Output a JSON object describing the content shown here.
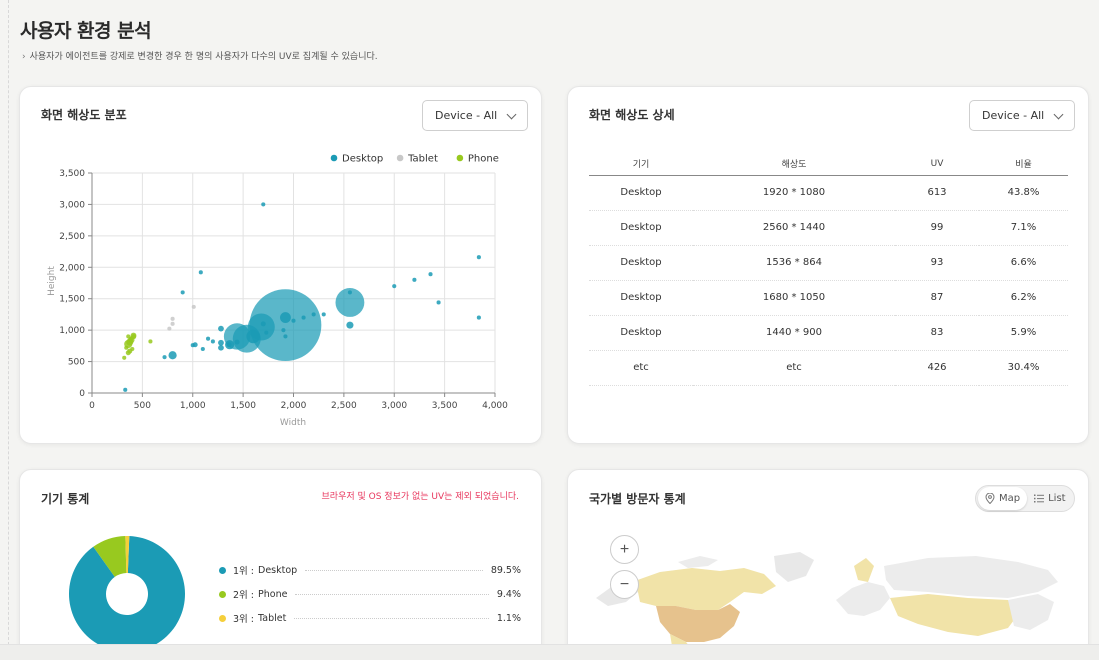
{
  "page": {
    "title": "사용자 환경 분석",
    "description": "사용자가 에이전트를 강제로 변경한 경우 한 명의 사용자가 다수의 UV로 집계될 수 있습니다."
  },
  "resolution_chart": {
    "title": "화면 해상도 분포",
    "device_filter": "Device - All",
    "legend": [
      {
        "name": "Desktop",
        "color": "#1b9bb5"
      },
      {
        "name": "Tablet",
        "color": "#c8c8c8"
      },
      {
        "name": "Phone",
        "color": "#98c91f"
      }
    ],
    "xlabel": "Width",
    "ylabel": "Height",
    "x_ticks": [
      "0",
      "500",
      "1,000",
      "1,500",
      "2,000",
      "2,500",
      "3,000",
      "3,500",
      "4,000"
    ],
    "y_ticks": [
      "0",
      "500",
      "1,000",
      "1,500",
      "2,000",
      "2,500",
      "3,000",
      "3,500"
    ]
  },
  "chart_data": {
    "type": "scatter",
    "xlabel": "Width",
    "ylabel": "Height",
    "xlim": [
      0,
      4000
    ],
    "ylim": [
      0,
      3500
    ],
    "grid": true,
    "legend_position": "top-right",
    "series": [
      {
        "name": "Desktop",
        "color": "#1b9bb5",
        "points": [
          {
            "x": 1920,
            "y": 1080,
            "uv": 613
          },
          {
            "x": 2560,
            "y": 1440,
            "uv": 99
          },
          {
            "x": 1536,
            "y": 864,
            "uv": 93
          },
          {
            "x": 1680,
            "y": 1050,
            "uv": 87
          },
          {
            "x": 1440,
            "y": 900,
            "uv": 83
          },
          {
            "x": 1600,
            "y": 900,
            "uv": 22
          },
          {
            "x": 1366,
            "y": 768,
            "uv": 10
          },
          {
            "x": 1920,
            "y": 1200,
            "uv": 14
          },
          {
            "x": 2560,
            "y": 1080,
            "uv": 6
          },
          {
            "x": 1280,
            "y": 1024,
            "uv": 4
          },
          {
            "x": 1280,
            "y": 720,
            "uv": 4
          },
          {
            "x": 1280,
            "y": 800,
            "uv": 4
          },
          {
            "x": 1360,
            "y": 768,
            "uv": 3
          },
          {
            "x": 1440,
            "y": 810,
            "uv": 3
          },
          {
            "x": 800,
            "y": 600,
            "uv": 8
          },
          {
            "x": 1024,
            "y": 768,
            "uv": 3
          },
          {
            "x": 1152,
            "y": 864,
            "uv": 2
          },
          {
            "x": 1700,
            "y": 1100,
            "uv": 3
          },
          {
            "x": 1730,
            "y": 960,
            "uv": 2
          },
          {
            "x": 1900,
            "y": 1000,
            "uv": 2
          },
          {
            "x": 1920,
            "y": 900,
            "uv": 2
          },
          {
            "x": 2000,
            "y": 1150,
            "uv": 2
          },
          {
            "x": 2100,
            "y": 1200,
            "uv": 2
          },
          {
            "x": 2200,
            "y": 1250,
            "uv": 2
          },
          {
            "x": 2300,
            "y": 1250,
            "uv": 2
          },
          {
            "x": 2560,
            "y": 1600,
            "uv": 2
          },
          {
            "x": 3000,
            "y": 1700,
            "uv": 2
          },
          {
            "x": 3200,
            "y": 1800,
            "uv": 2
          },
          {
            "x": 3360,
            "y": 1890,
            "uv": 2
          },
          {
            "x": 3440,
            "y": 1440,
            "uv": 2
          },
          {
            "x": 3840,
            "y": 2160,
            "uv": 2
          },
          {
            "x": 3840,
            "y": 1200,
            "uv": 2
          },
          {
            "x": 1080,
            "y": 1920,
            "uv": 2
          },
          {
            "x": 1700,
            "y": 3000,
            "uv": 2
          },
          {
            "x": 900,
            "y": 1600,
            "uv": 2
          },
          {
            "x": 1000,
            "y": 760,
            "uv": 2
          },
          {
            "x": 1100,
            "y": 700,
            "uv": 2
          },
          {
            "x": 1200,
            "y": 820,
            "uv": 2
          },
          {
            "x": 330,
            "y": 50,
            "uv": 2
          },
          {
            "x": 720,
            "y": 570,
            "uv": 2
          }
        ]
      },
      {
        "name": "Tablet",
        "color": "#c8c8c8",
        "points": [
          {
            "x": 800,
            "y": 1180,
            "uv": 2
          },
          {
            "x": 800,
            "y": 1100,
            "uv": 2
          },
          {
            "x": 768,
            "y": 1024,
            "uv": 2
          },
          {
            "x": 1010,
            "y": 1370,
            "uv": 2
          }
        ]
      },
      {
        "name": "Phone",
        "color": "#98c91f",
        "points": [
          {
            "x": 360,
            "y": 780,
            "uv": 8
          },
          {
            "x": 375,
            "y": 812,
            "uv": 6
          },
          {
            "x": 390,
            "y": 844,
            "uv": 5
          },
          {
            "x": 412,
            "y": 915,
            "uv": 4
          },
          {
            "x": 360,
            "y": 640,
            "uv": 3
          },
          {
            "x": 375,
            "y": 667,
            "uv": 3
          },
          {
            "x": 414,
            "y": 896,
            "uv": 3
          },
          {
            "x": 393,
            "y": 873,
            "uv": 2
          },
          {
            "x": 340,
            "y": 720,
            "uv": 2
          },
          {
            "x": 320,
            "y": 560,
            "uv": 2
          },
          {
            "x": 384,
            "y": 854,
            "uv": 2
          },
          {
            "x": 400,
            "y": 700,
            "uv": 2
          },
          {
            "x": 360,
            "y": 900,
            "uv": 2
          },
          {
            "x": 580,
            "y": 820,
            "uv": 2
          }
        ]
      }
    ]
  },
  "resolution_detail": {
    "title": "화면 해상도 상세",
    "device_filter": "Device - All",
    "columns": [
      "기기",
      "해상도",
      "UV",
      "비율"
    ],
    "rows": [
      [
        "Desktop",
        "1920 * 1080",
        "613",
        "43.8%"
      ],
      [
        "Desktop",
        "2560 * 1440",
        "99",
        "7.1%"
      ],
      [
        "Desktop",
        "1536 * 864",
        "93",
        "6.6%"
      ],
      [
        "Desktop",
        "1680 * 1050",
        "87",
        "6.2%"
      ],
      [
        "Desktop",
        "1440 * 900",
        "83",
        "5.9%"
      ],
      [
        "etc",
        "etc",
        "426",
        "30.4%"
      ]
    ]
  },
  "device_stats": {
    "title": "기기 통계",
    "note": "브라우저 및 OS 정보가 없는 UV는 제외 되었습니다.",
    "items": [
      {
        "rank": "1위 :",
        "name": "Desktop",
        "pct": "89.5%",
        "value": 89.5,
        "color": "#1b9bb5"
      },
      {
        "rank": "2위 :",
        "name": "Phone",
        "pct": "9.4%",
        "value": 9.4,
        "color": "#98c91f"
      },
      {
        "rank": "3위 :",
        "name": "Tablet",
        "pct": "1.1%",
        "value": 1.1,
        "color": "#f5cf3b"
      }
    ]
  },
  "country_stats": {
    "title": "국가별 방문자 통계",
    "toggle": {
      "map": "Map",
      "list": "List",
      "active": "map"
    },
    "zoom_in": "+",
    "zoom_out": "−"
  }
}
